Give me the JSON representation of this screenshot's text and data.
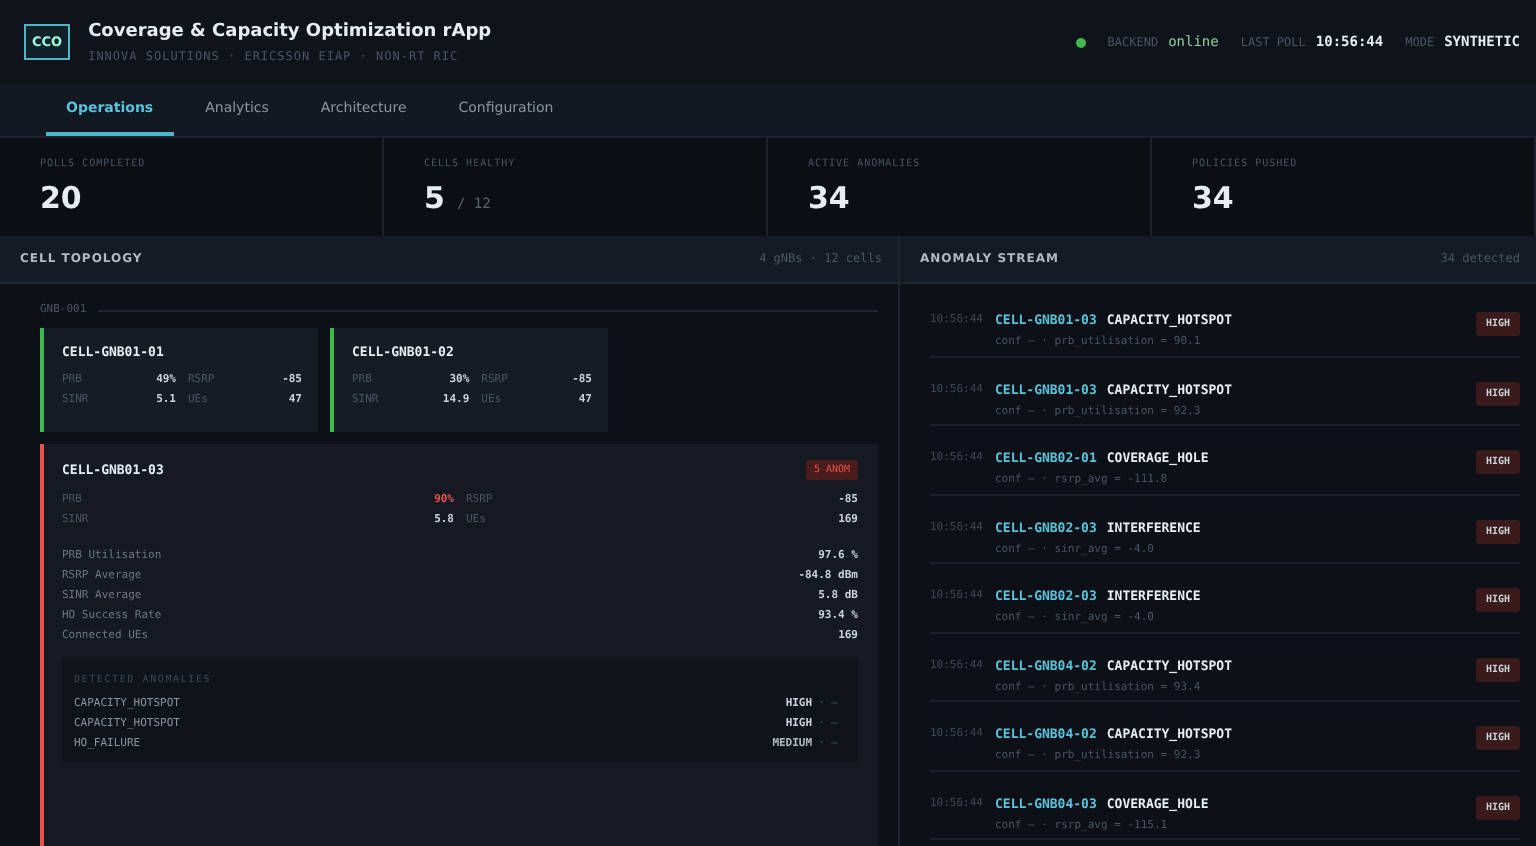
{
  "header": {
    "logo": "CCO",
    "title": "Coverage & Capacity Optimization rApp",
    "subtitle": "INNOVA SOLUTIONS · ERICSSON EIAP · NON-RT RIC",
    "status": [
      {
        "kind": "backend",
        "label": "BACKEND",
        "value": "online",
        "online": true
      },
      {
        "kind": "text",
        "label": "LAST POLL",
        "value": "10:56:44"
      },
      {
        "kind": "text",
        "label": "MODE",
        "value": "SYNTHETIC"
      }
    ]
  },
  "tabs": [
    {
      "label": "Operations",
      "selected": true
    },
    {
      "label": "Analytics",
      "selected": false
    },
    {
      "label": "Architecture",
      "selected": false
    },
    {
      "label": "Configuration",
      "selected": false
    }
  ],
  "stats": [
    {
      "label": "POLLS COMPLETED",
      "value": "20"
    },
    {
      "label": "CELLS HEALTHY",
      "value": "5",
      "suffix": "/ 12"
    },
    {
      "label": "ACTIVE ANOMALIES",
      "value": "34"
    },
    {
      "label": "POLICIES PUSHED",
      "value": "34"
    }
  ],
  "topology": {
    "title": "CELL TOPOLOGY",
    "summary": "4 gNBs · 12 cells",
    "group": "GNB-001",
    "cells": [
      {
        "name": "CELL-GNB01-01",
        "anomalous": false,
        "metrics": [
          {
            "label": "PRB",
            "value": "49%",
            "alarm": false
          },
          {
            "label": "RSRP",
            "value": "-85",
            "alarm": false
          },
          {
            "label": "SINR",
            "value": "5.1",
            "alarm": false
          },
          {
            "label": "UEs",
            "value": "47",
            "alarm": false
          }
        ]
      },
      {
        "name": "CELL-GNB01-02",
        "anomalous": false,
        "metrics": [
          {
            "label": "PRB",
            "value": "30%",
            "alarm": false
          },
          {
            "label": "RSRP",
            "value": "-85",
            "alarm": false
          },
          {
            "label": "SINR",
            "value": "14.9",
            "alarm": false
          },
          {
            "label": "UEs",
            "value": "47",
            "alarm": false
          }
        ]
      }
    ],
    "expanded": {
      "name": "CELL-GNB01-03",
      "anomalous": true,
      "badge": "5 ANOM",
      "metrics": [
        {
          "label": "PRB",
          "value": "90%",
          "alarm": true
        },
        {
          "label": "RSRP",
          "value": "-85",
          "alarm": false
        },
        {
          "label": "SINR",
          "value": "5.8",
          "alarm": false
        },
        {
          "label": "UEs",
          "value": "169",
          "alarm": false
        }
      ],
      "details": [
        {
          "label": "PRB Utilisation",
          "value": "97.6 %"
        },
        {
          "label": "RSRP Average",
          "value": "-84.8 dBm"
        },
        {
          "label": "SINR Average",
          "value": "5.8 dB"
        },
        {
          "label": "HO Success Rate",
          "value": "93.4 %"
        },
        {
          "label": "Connected UEs",
          "value": "169"
        }
      ],
      "anomalies_title": "DETECTED ANOMALIES",
      "anomalies": [
        {
          "type": "CAPACITY_HOTSPOT",
          "severity": "HIGH",
          "extra": "· —"
        },
        {
          "type": "CAPACITY_HOTSPOT",
          "severity": "HIGH",
          "extra": "· —"
        },
        {
          "type": "HO_FAILURE",
          "severity": "MEDIUM",
          "extra": "· —"
        }
      ]
    }
  },
  "stream": {
    "title": "ANOMALY STREAM",
    "count": "34 detected",
    "items": [
      {
        "time": "10:56:44",
        "cell": "CELL-GNB01-03",
        "type": "CAPACITY_HOTSPOT",
        "detail": "conf — · prb_utilisation = 90.1",
        "severity": "HIGH"
      },
      {
        "time": "10:56:44",
        "cell": "CELL-GNB01-03",
        "type": "CAPACITY_HOTSPOT",
        "detail": "conf — · prb_utilisation = 92.3",
        "severity": "HIGH"
      },
      {
        "time": "10:56:44",
        "cell": "CELL-GNB02-01",
        "type": "COVERAGE_HOLE",
        "detail": "conf — · rsrp_avg = -111.8",
        "severity": "HIGH"
      },
      {
        "time": "10:56:44",
        "cell": "CELL-GNB02-03",
        "type": "INTERFERENCE",
        "detail": "conf — · sinr_avg = -4.0",
        "severity": "HIGH"
      },
      {
        "time": "10:56:44",
        "cell": "CELL-GNB02-03",
        "type": "INTERFERENCE",
        "detail": "conf — · sinr_avg = -4.0",
        "severity": "HIGH"
      },
      {
        "time": "10:56:44",
        "cell": "CELL-GNB04-02",
        "type": "CAPACITY_HOTSPOT",
        "detail": "conf — · prb_utilisation = 93.4",
        "severity": "HIGH"
      },
      {
        "time": "10:56:44",
        "cell": "CELL-GNB04-02",
        "type": "CAPACITY_HOTSPOT",
        "detail": "conf — · prb_utilisation = 92.3",
        "severity": "HIGH"
      },
      {
        "time": "10:56:44",
        "cell": "CELL-GNB04-03",
        "type": "COVERAGE_HOLE",
        "detail": "conf — · rsrp_avg = -115.1",
        "severity": "HIGH"
      }
    ]
  }
}
